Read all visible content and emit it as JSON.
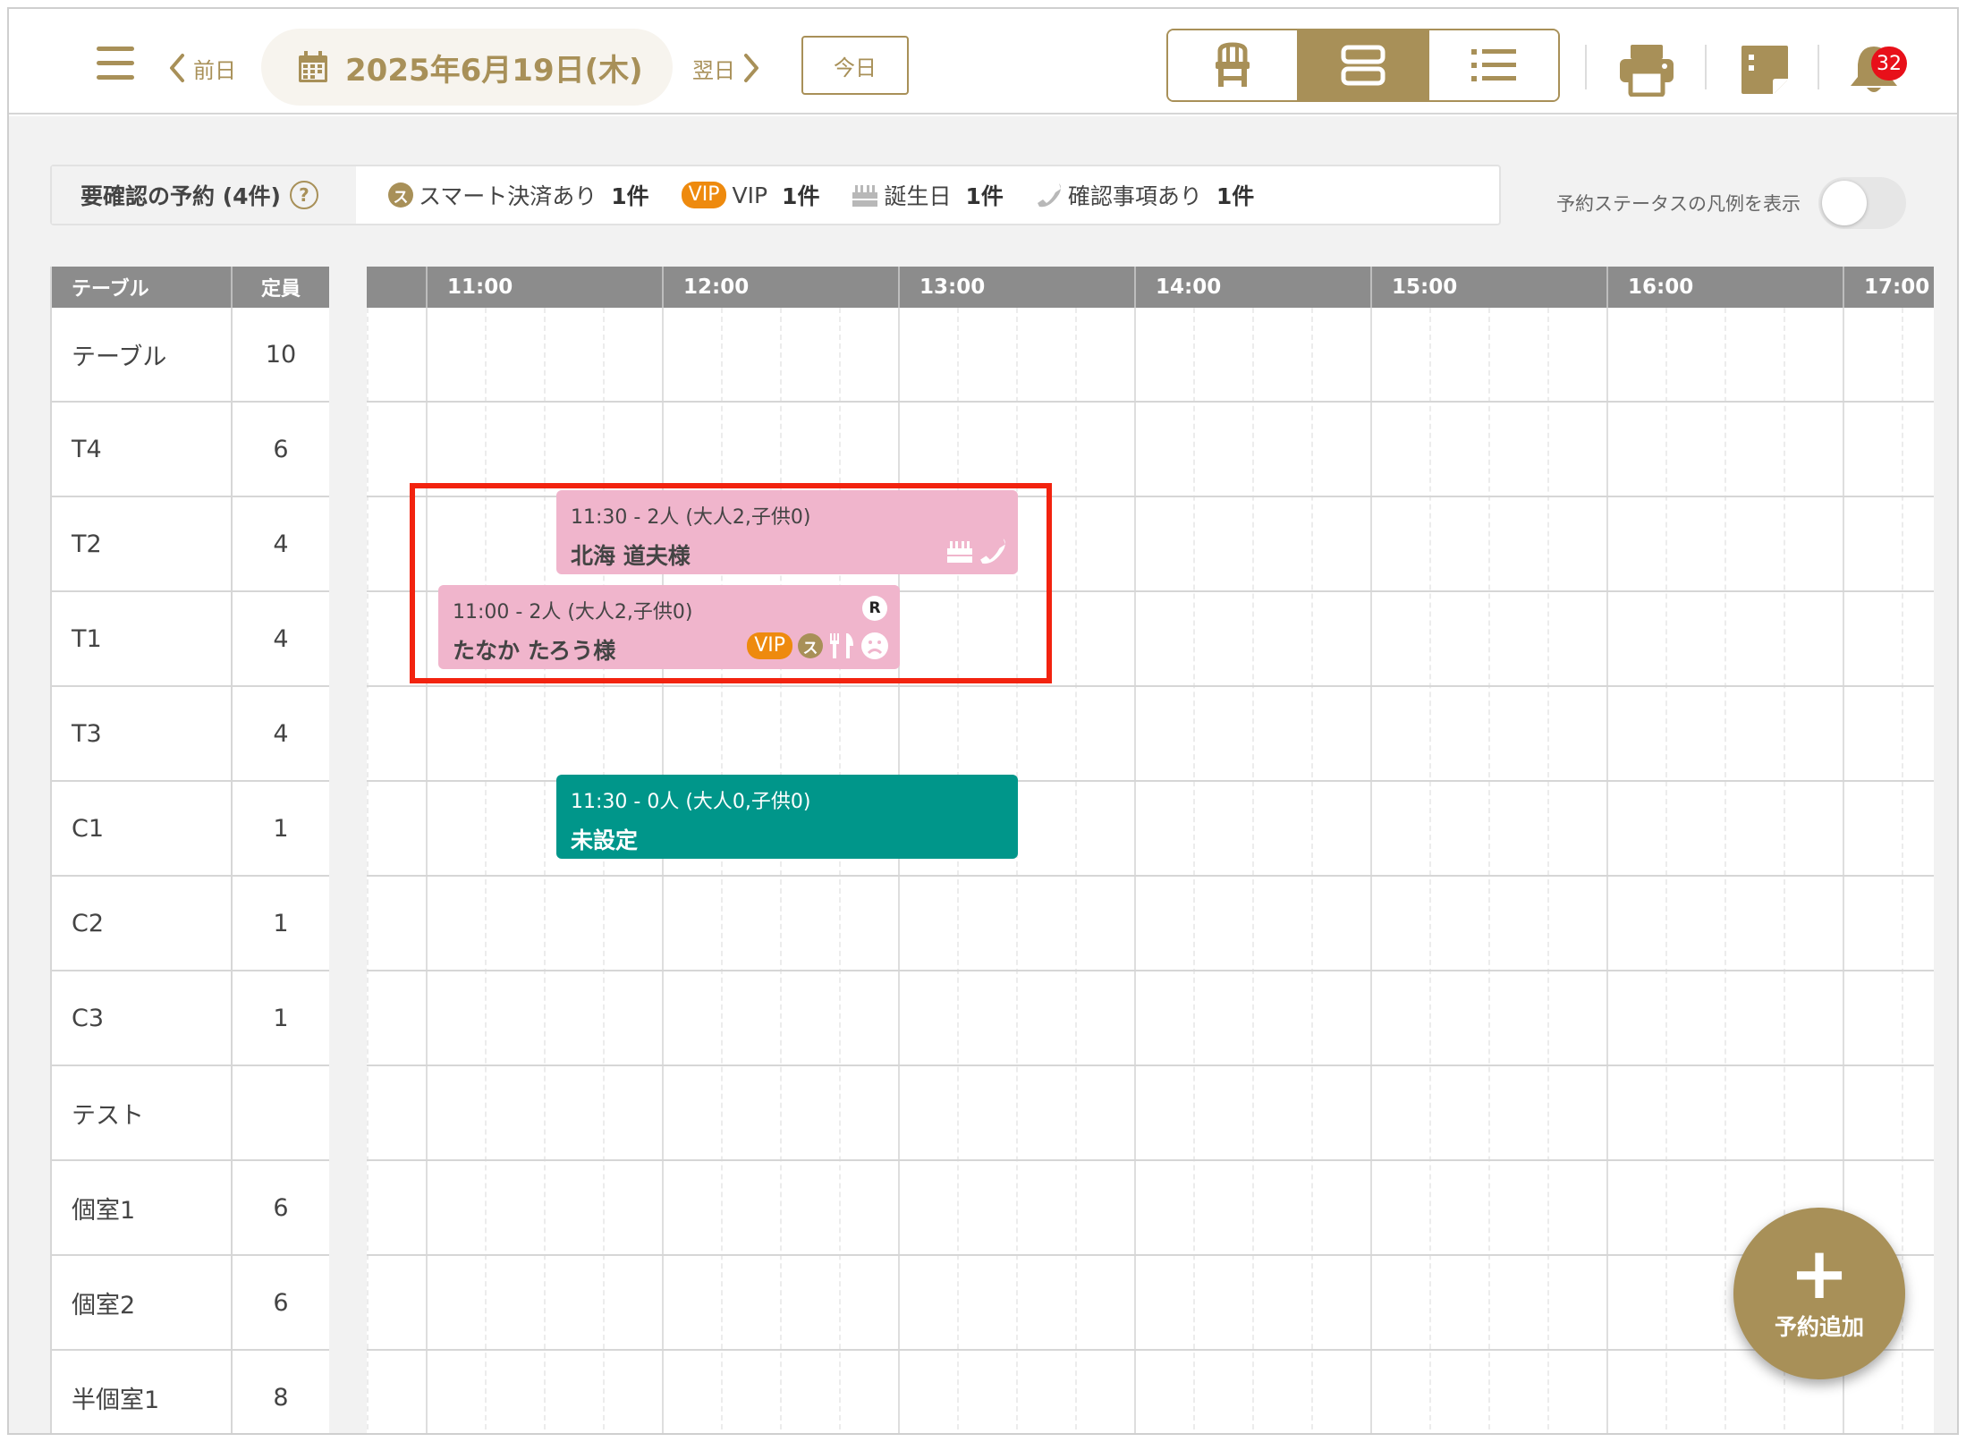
{
  "header": {
    "prev_label": "前日",
    "date": "2025年6月19日(木)",
    "next_label": "翌日",
    "today_label": "今日",
    "notification_count": "32",
    "accent_color": "#a89058",
    "views": [
      "chair-view",
      "timeline-view",
      "list-view"
    ],
    "active_view": "timeline-view"
  },
  "summary": {
    "title": "要確認の予約 (4件)",
    "help_glyph": "?",
    "smart_badge": "ス",
    "smart_label": "スマート決済あり",
    "smart_count": "1件",
    "vip_badge": "VIP",
    "vip_label": "VIP",
    "vip_count": "1件",
    "birthday_label": "誕生日",
    "birthday_count": "1件",
    "confirm_label": "確認事項あり",
    "confirm_count": "1件",
    "legend_label": "予約ステータスの凡例を表示"
  },
  "tables": {
    "header_table": "テーブル",
    "header_capacity": "定員",
    "rows": [
      {
        "name": "テーブル",
        "capacity": "10"
      },
      {
        "name": "T4",
        "capacity": "6"
      },
      {
        "name": "T2",
        "capacity": "4"
      },
      {
        "name": "T1",
        "capacity": "4"
      },
      {
        "name": "T3",
        "capacity": "4"
      },
      {
        "name": "C1",
        "capacity": "1"
      },
      {
        "name": "C2",
        "capacity": "1"
      },
      {
        "name": "C3",
        "capacity": "1"
      },
      {
        "name": "テスト",
        "capacity": ""
      },
      {
        "name": "個室1",
        "capacity": "6"
      },
      {
        "name": "個室2",
        "capacity": "6"
      },
      {
        "name": "半個室1",
        "capacity": "8"
      }
    ]
  },
  "timeline": {
    "hours": [
      "11:00",
      "12:00",
      "13:00",
      "14:00",
      "15:00",
      "16:00",
      "17:00"
    ]
  },
  "reservations": [
    {
      "time": "11:30 - 2人 (大人2,子供0)",
      "name": "北海 道夫様",
      "table": "T2",
      "status_color": "#f0b5cc"
    },
    {
      "time": "11:00 - 2人 (大人2,子供0)",
      "name": "たなか たろう様",
      "table": "T1",
      "status_color": "#f0b5cc",
      "vip_badge": "VIP",
      "smart_badge": "ス",
      "source_badge": "R"
    },
    {
      "time": "11:30 - 0人 (大人0,子供0)",
      "name": "未設定",
      "table": "C1",
      "status_color": "#00968a"
    }
  ],
  "fab": {
    "plus": "+",
    "label": "予約追加"
  }
}
